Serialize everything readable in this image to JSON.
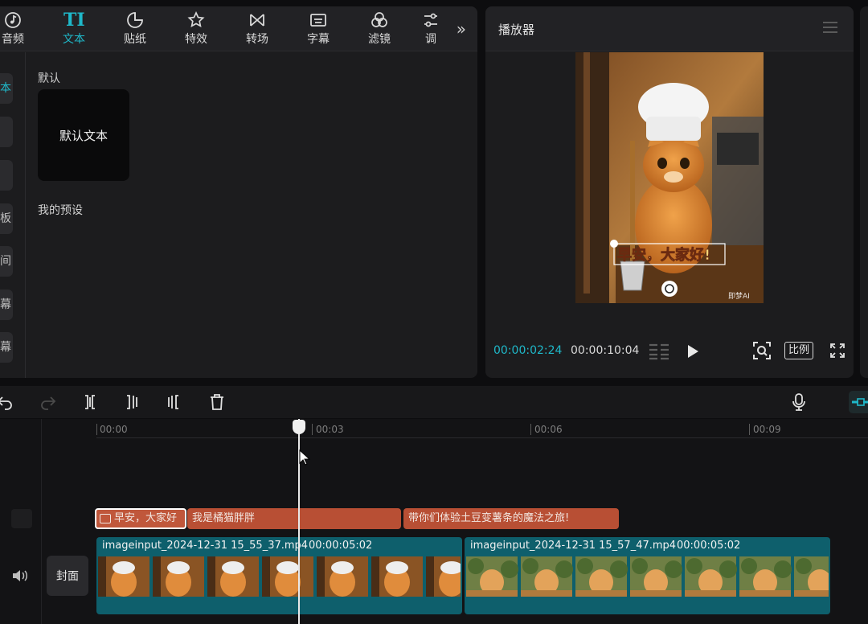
{
  "tabs": [
    {
      "label": "音频",
      "icon": "music-note-icon"
    },
    {
      "label": "文本",
      "icon": "text-icon",
      "active": true,
      "glyph": "TI"
    },
    {
      "label": "贴纸",
      "icon": "sticker-icon"
    },
    {
      "label": "特效",
      "icon": "effects-star-icon"
    },
    {
      "label": "转场",
      "icon": "transition-icon"
    },
    {
      "label": "字幕",
      "icon": "subtitle-icon"
    },
    {
      "label": "滤镜",
      "icon": "filter-icon"
    },
    {
      "label": "调",
      "icon": "adjust-icon"
    }
  ],
  "tabs_more": "»",
  "side_nav": [
    "本",
    "",
    "",
    "板",
    "间",
    "幕",
    "幕"
  ],
  "content": {
    "default_label": "默认",
    "default_card_text": "默认文本",
    "presets_label": "我的预设"
  },
  "player": {
    "title": "播放器",
    "time_current": "00:00:02:24",
    "time_total": "00:00:10:04",
    "ratio_label": "比例",
    "subtitle_overlay": "早安，大家好!",
    "watermark": "即梦AI"
  },
  "timeline": {
    "ruler_labels": [
      "00:00",
      "00:03",
      "00:06",
      "00:09"
    ],
    "text_clips": [
      "早安，大家好",
      "我是橘猫胖胖",
      "带你们体验土豆变薯条的魔法之旅!"
    ],
    "video_clips": [
      {
        "name": "imageinput_2024-12-31 15_55_37.mp4",
        "duration": "00:00:05:02"
      },
      {
        "name": "imageinput_2024-12-31 15_57_47.mp4",
        "duration": "00:00:05:02"
      }
    ],
    "cover_label": "封面"
  },
  "colors": {
    "accent": "#1fb8c9",
    "text_clip": "#b84f34",
    "video_clip": "#0e5f6c"
  }
}
